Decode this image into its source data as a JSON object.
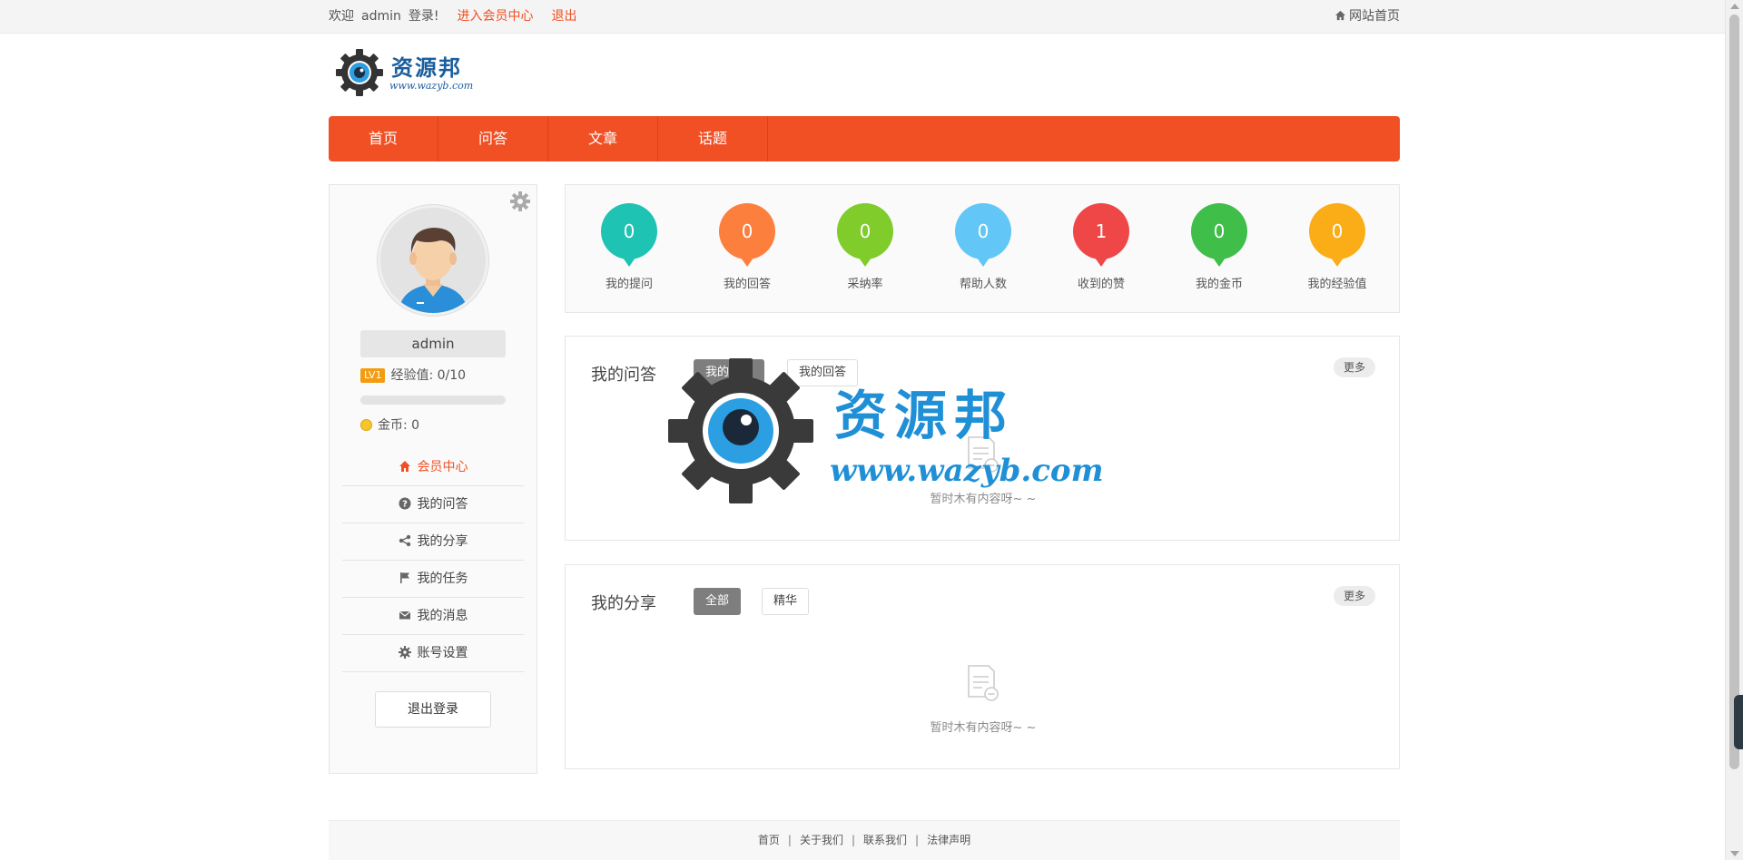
{
  "topbar": {
    "welcome": "欢迎",
    "username": "admin",
    "logged_in": "登录!",
    "member_center_link": "进入会员中心",
    "logout_link": "退出",
    "site_home": "网站首页"
  },
  "logo": {
    "name": "资源邦",
    "url": "www.wazyb.com"
  },
  "nav": {
    "items": [
      "首页",
      "问答",
      "文章",
      "话题"
    ]
  },
  "sidebar": {
    "username": "admin",
    "level_badge": "LV1",
    "exp_label": "经验值: 0/10",
    "exp_progress": 0,
    "coins_label": "金币: 0",
    "menu": [
      {
        "label": "会员中心",
        "icon": "home-icon",
        "active": true
      },
      {
        "label": "我的问答",
        "icon": "question-icon",
        "active": false
      },
      {
        "label": "我的分享",
        "icon": "share-icon",
        "active": false
      },
      {
        "label": "我的任务",
        "icon": "flag-icon",
        "active": false
      },
      {
        "label": "我的消息",
        "icon": "envelope-icon",
        "active": false
      },
      {
        "label": "账号设置",
        "icon": "gear-icon",
        "active": false
      }
    ],
    "logout_button": "退出登录"
  },
  "stats": [
    {
      "value": "0",
      "label": "我的提问",
      "color": "#1ec3b4"
    },
    {
      "value": "0",
      "label": "我的回答",
      "color": "#fd7f3e"
    },
    {
      "value": "0",
      "label": "采纳率",
      "color": "#7fcc2a"
    },
    {
      "value": "0",
      "label": "帮助人数",
      "color": "#62c7f6"
    },
    {
      "value": "1",
      "label": "收到的赞",
      "color": "#ef4747"
    },
    {
      "value": "0",
      "label": "我的金币",
      "color": "#3fbe4a"
    },
    {
      "value": "0",
      "label": "我的经验值",
      "color": "#fbad18"
    }
  ],
  "questions_panel": {
    "title": "我的问答",
    "tabs": [
      "我的提问",
      "我的回答"
    ],
    "more": "更多",
    "empty": "暂时木有内容呀~ ~"
  },
  "shares_panel": {
    "title": "我的分享",
    "tabs": [
      "全部",
      "精华"
    ],
    "more": "更多",
    "empty": "暂时木有内容呀~ ~"
  },
  "watermark": {
    "name": "资源邦",
    "url": "www.wazyb.com"
  },
  "footer": {
    "links": [
      "首页",
      "关于我们",
      "联系我们",
      "法律声明"
    ]
  }
}
